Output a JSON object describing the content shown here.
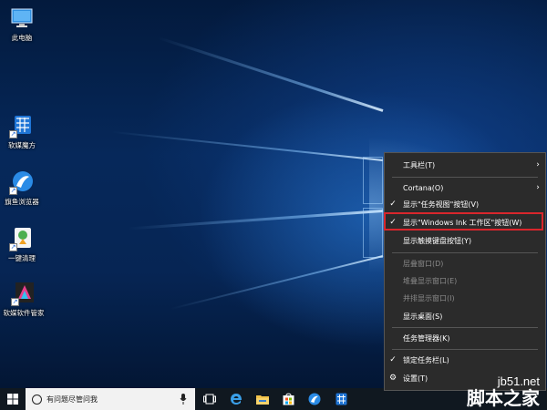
{
  "desktop": {
    "icons": [
      {
        "label": "此电脑",
        "icon": "computer-icon"
      },
      {
        "label": "软媒魔方",
        "icon": "rubik-cube-icon"
      },
      {
        "label": "旗鱼浏览器",
        "icon": "browser-icon"
      },
      {
        "label": "一键清理",
        "icon": "cleaner-icon"
      },
      {
        "label": "软媒软件管家",
        "icon": "software-manager-icon"
      }
    ]
  },
  "taskbar": {
    "search_placeholder": "有问题尽管问我",
    "icons": [
      "windows-start-icon",
      "search-icon",
      "microphone-icon",
      "task-view-icon",
      "edge-icon",
      "file-explorer-icon",
      "store-icon",
      "browser-icon",
      "rubik-cube-icon"
    ]
  },
  "context_menu": {
    "items": [
      {
        "label": "工具栏(T)",
        "checked": false,
        "submenu": true,
        "disabled": false
      },
      {
        "label": "Cortana(O)",
        "checked": false,
        "submenu": true,
        "disabled": false
      },
      {
        "label": "显示\"任务视图\"按钮(V)",
        "checked": true,
        "submenu": false,
        "disabled": false
      },
      {
        "label": "显示\"Windows Ink 工作区\"按钮(W)",
        "checked": true,
        "submenu": false,
        "disabled": false
      },
      {
        "label": "显示触摸键盘按钮(Y)",
        "checked": false,
        "submenu": false,
        "disabled": false
      },
      {
        "label": "层叠窗口(D)",
        "checked": false,
        "submenu": false,
        "disabled": true
      },
      {
        "label": "堆叠显示窗口(E)",
        "checked": false,
        "submenu": false,
        "disabled": true
      },
      {
        "label": "并排显示窗口(I)",
        "checked": false,
        "submenu": false,
        "disabled": true
      },
      {
        "label": "显示桌面(S)",
        "checked": false,
        "submenu": false,
        "disabled": false
      },
      {
        "label": "任务管理器(K)",
        "checked": false,
        "submenu": false,
        "disabled": false
      },
      {
        "label": "锁定任务栏(L)",
        "checked": true,
        "submenu": false,
        "disabled": false
      },
      {
        "label": "设置(T)",
        "checked": false,
        "submenu": false,
        "disabled": false
      }
    ],
    "check_mark": "✓",
    "arrow": "›",
    "highlight_color": "#d9262c"
  },
  "watermark": {
    "site": "jb51.net",
    "brand": "脚本之家"
  },
  "colors": {
    "taskbar": "#101820",
    "menu_bg": "#2b2b2b",
    "wallpaper_blue": "#06285a"
  }
}
